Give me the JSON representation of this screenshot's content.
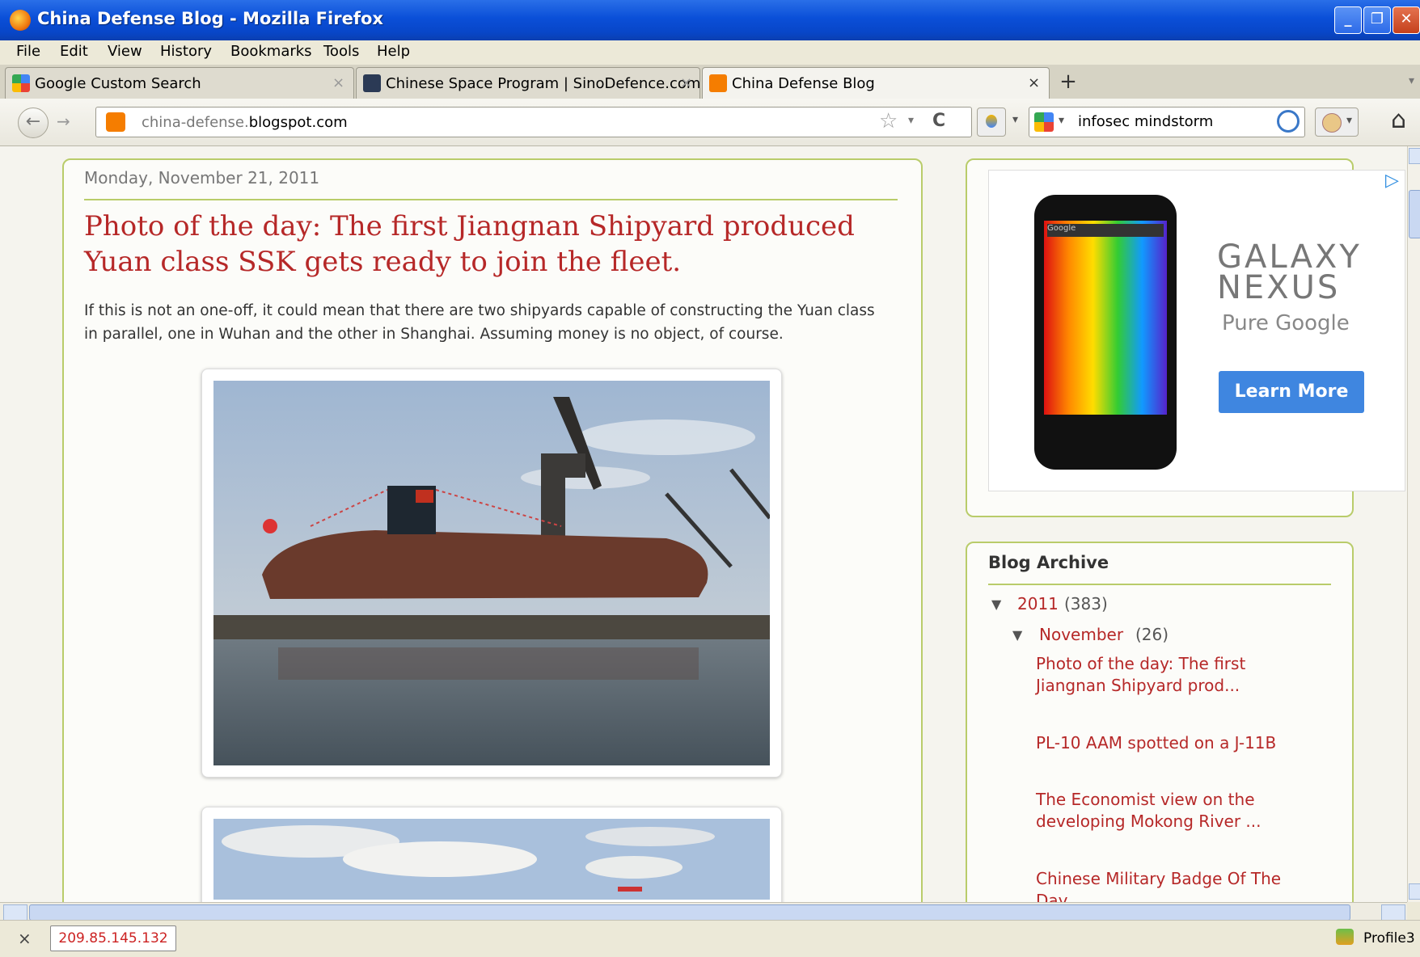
{
  "window": {
    "title": "China Defense Blog - Mozilla Firefox",
    "btn_min": "_",
    "btn_max": "❐",
    "btn_close": "✕"
  },
  "menu": [
    "File",
    "Edit",
    "View",
    "History",
    "Bookmarks",
    "Tools",
    "Help"
  ],
  "tabs": [
    {
      "label": "Google Custom Search",
      "close": "×"
    },
    {
      "label": "Chinese Space Program | SinoDefence.com",
      "close": "×"
    },
    {
      "label": "China Defense Blog",
      "close": "×"
    }
  ],
  "new_tab": "+",
  "nav": {
    "url_prefix": "china-defense.",
    "url_domain": "blogspot.com",
    "search_value": "infosec mindstorm",
    "back": "←",
    "forward": "→",
    "reload": "C",
    "star": "☆",
    "home": "⌂",
    "dropdown": "▾"
  },
  "post": {
    "date": "Monday, November 21, 2011",
    "title": "Photo of the day: The first Jiangnan Shipyard produced Yuan class SSK gets ready to join the fleet.",
    "body": "If this is not an one-off, it could mean that there are two shipyards capable of constructing the Yuan class in parallel, one in Wuhan and the other in Shanghai.  Assuming money is no object, of course."
  },
  "ad": {
    "brand_line1": "GALAXY",
    "brand_line2": "NEXUS",
    "tagline": "Pure Google",
    "cta": "Learn More",
    "adchoice": "▷",
    "phone_search": "Google"
  },
  "archive": {
    "title": "Blog Archive",
    "year": "2011",
    "year_count": "(383)",
    "month": "November",
    "month_count": "(26)",
    "toggle": "▼",
    "posts": [
      "Photo of the day: The first Jiangnan Shipyard prod...",
      "PL-10 AAM spotted on a J-11B",
      "The Economist view on the developing Mokong River ...",
      "Chinese Military Badge Of The Day..."
    ]
  },
  "status": {
    "close": "×",
    "ip": "209.85.145.132",
    "profile": "Profile3"
  },
  "colors": {
    "link_red": "#b62828",
    "panel_border": "#b9cc6a",
    "title_blue": "#0a4fd8"
  }
}
